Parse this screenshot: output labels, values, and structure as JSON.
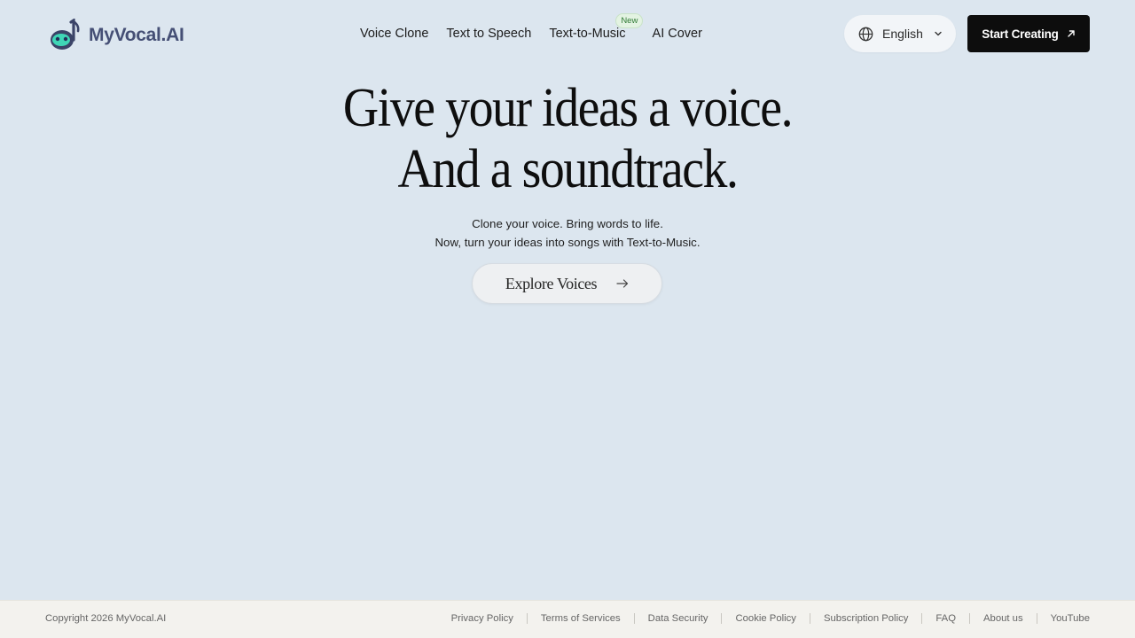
{
  "header": {
    "logo_text": "MyVocal.AI",
    "nav": [
      {
        "label": "Voice Clone"
      },
      {
        "label": "Text to Speech"
      },
      {
        "label": "Text-to-Music",
        "badge": "New"
      },
      {
        "label": "AI Cover"
      }
    ],
    "language": {
      "selected": "English",
      "icon": "globe-icon"
    },
    "cta_label": "Start Creating"
  },
  "hero": {
    "headline_line1": "Give your ideas a voice.",
    "headline_line2": "And a soundtrack.",
    "subtitle_line1": "Clone your voice. Bring words to life.",
    "subtitle_line2": "Now, turn your ideas into songs with Text-to-Music.",
    "explore_label": "Explore Voices"
  },
  "footer": {
    "copyright": "Copyright 2026 MyVocal.AI",
    "links": [
      {
        "label": "Privacy Policy"
      },
      {
        "label": "Terms of Services"
      },
      {
        "label": "Data Security"
      },
      {
        "label": "Cookie Policy"
      },
      {
        "label": "Subscription Policy"
      },
      {
        "label": "FAQ"
      },
      {
        "label": "About us"
      },
      {
        "label": "YouTube"
      }
    ]
  },
  "colors": {
    "background": "#dce6ef",
    "logo_text": "#454f75",
    "logo_accent": "#3fd6b6",
    "cta_background": "#0d0d0d",
    "badge_background": "#e3f3e2",
    "footer_background": "#f3f2ee"
  }
}
